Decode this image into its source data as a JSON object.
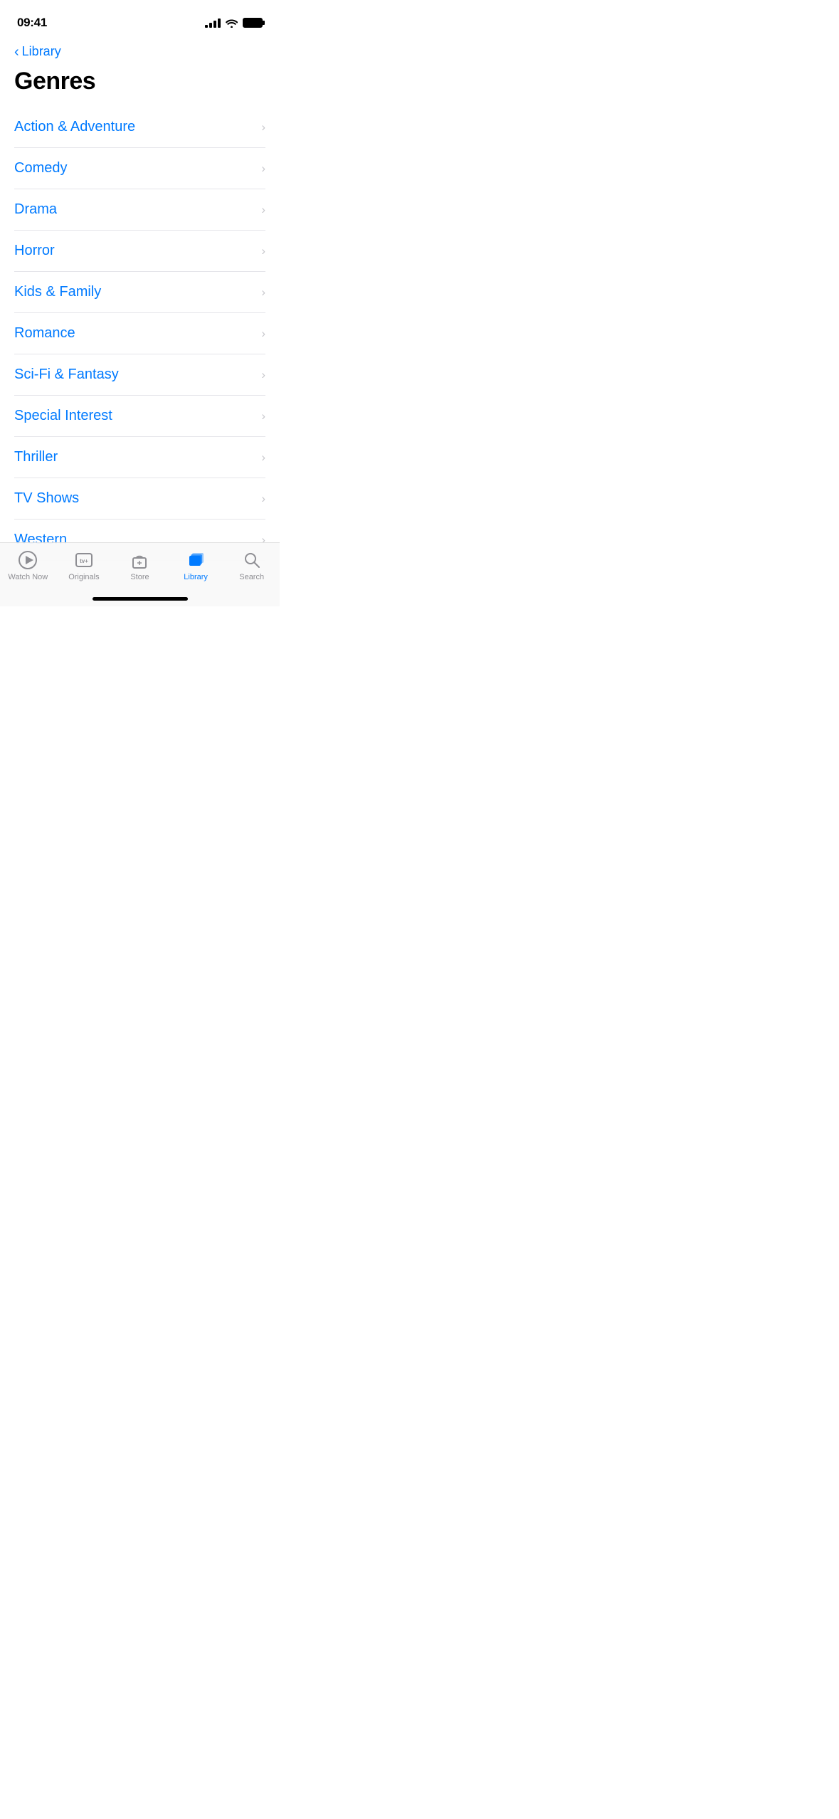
{
  "statusBar": {
    "time": "09:41"
  },
  "navigation": {
    "backLabel": "Library"
  },
  "page": {
    "title": "Genres"
  },
  "genres": [
    {
      "label": "Action & Adventure"
    },
    {
      "label": "Comedy"
    },
    {
      "label": "Drama"
    },
    {
      "label": "Horror"
    },
    {
      "label": "Kids & Family"
    },
    {
      "label": "Romance"
    },
    {
      "label": "Sci-Fi & Fantasy"
    },
    {
      "label": "Special Interest"
    },
    {
      "label": "Thriller"
    },
    {
      "label": "TV Shows"
    },
    {
      "label": "Western"
    }
  ],
  "tabBar": {
    "items": [
      {
        "id": "watch-now",
        "label": "Watch Now",
        "active": false
      },
      {
        "id": "originals",
        "label": "Originals",
        "active": false
      },
      {
        "id": "store",
        "label": "Store",
        "active": false
      },
      {
        "id": "library",
        "label": "Library",
        "active": true
      },
      {
        "id": "search",
        "label": "Search",
        "active": false
      }
    ]
  }
}
